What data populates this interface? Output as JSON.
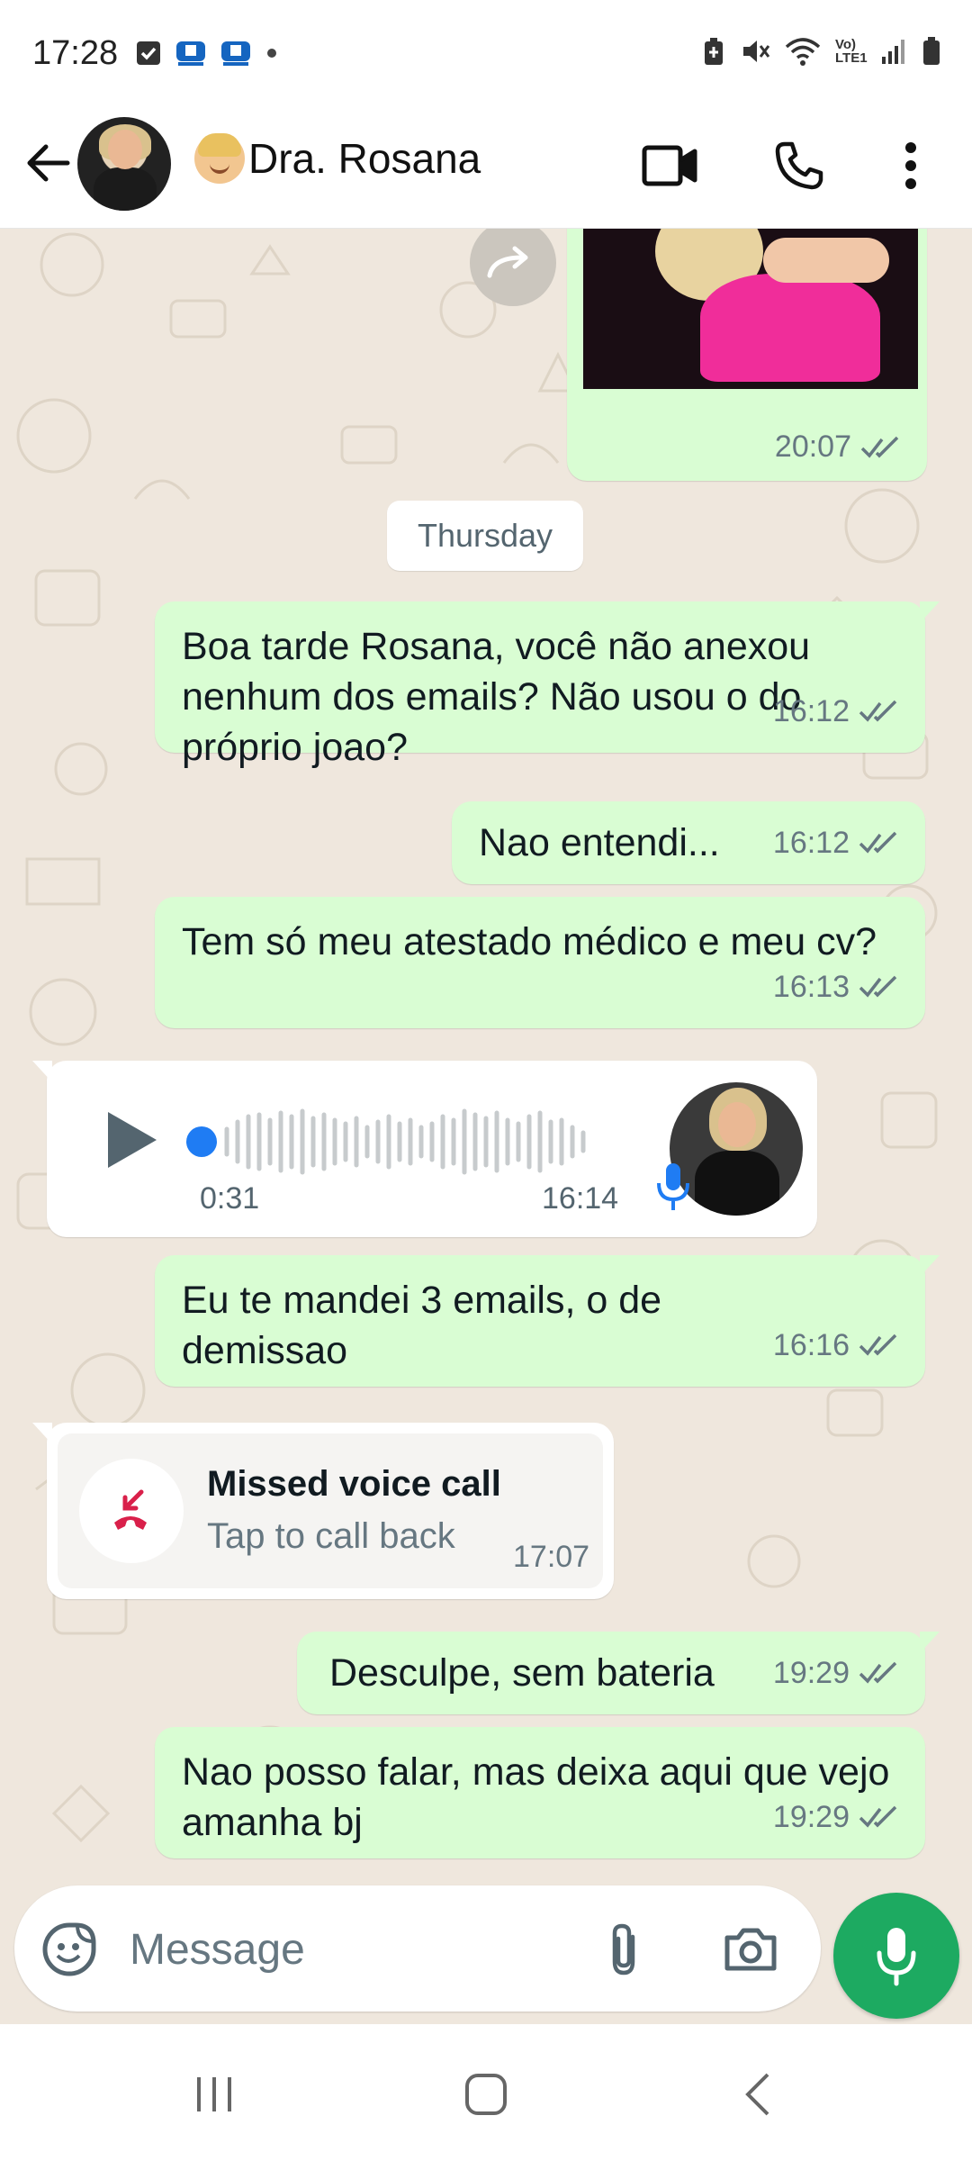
{
  "status_bar": {
    "time": "17:28",
    "network_label": "Vo) LTE1"
  },
  "header": {
    "contact_name": "Dra. Rosana"
  },
  "messages": [
    {
      "time": "20:07"
    },
    {
      "date_separator": "Thursday"
    },
    {
      "text": "Boa tarde Rosana, você não anexou nenhum dos emails? Não usou o do próprio joao?",
      "time": "16:12"
    },
    {
      "text": "Nao entendi...",
      "time": "16:12"
    },
    {
      "text": "Tem só meu atestado médico e meu cv?",
      "time": "16:13"
    },
    {
      "voice_duration": "0:31",
      "time": "16:14"
    },
    {
      "text": "Eu te mandei 3 emails, o de demissao",
      "time": "16:16"
    },
    {
      "call_title": "Missed voice call",
      "call_subtitle": "Tap to call back",
      "time": "17:07"
    },
    {
      "text": "Desculpe, sem bateria",
      "time": "19:29"
    },
    {
      "text": "Nao posso falar, mas deixa aqui que vejo amanha bj",
      "time": "19:29"
    }
  ],
  "composer": {
    "placeholder": "Message"
  },
  "colors": {
    "outgoing_bubble": "#d9fdd3",
    "chat_bg": "#efe7dd",
    "accent_green": "#1daa61",
    "missed_call_red": "#d9204a",
    "voice_dot": "#1f7cf3"
  }
}
